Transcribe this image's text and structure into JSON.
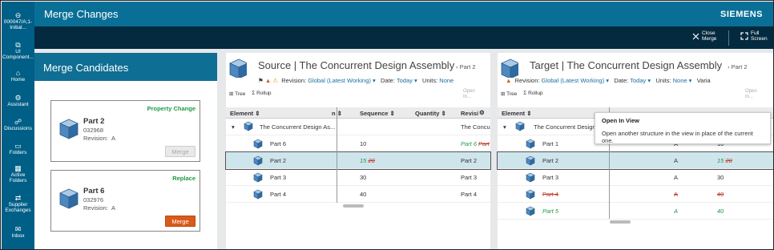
{
  "window": {
    "title": "Merge Changes",
    "brand": "SIEMENS"
  },
  "toolbar": {
    "close_merge": [
      "Close",
      "Merge"
    ],
    "full_screen": [
      "Full",
      "Screen"
    ]
  },
  "nav": [
    {
      "icon": "back-icon",
      "lines": [
        "000047/A;1-",
        "Initial..."
      ]
    },
    {
      "icon": "ui-component-icon",
      "lines": [
        "UI",
        "Component..."
      ]
    },
    {
      "icon": "home-icon",
      "lines": [
        "Home"
      ]
    },
    {
      "icon": "assistant-icon",
      "lines": [
        "Assistant"
      ]
    },
    {
      "icon": "discussions-icon",
      "lines": [
        "Discussions"
      ]
    },
    {
      "icon": "folders-icon",
      "lines": [
        "Folders"
      ]
    },
    {
      "icon": "active-folders-icon",
      "lines": [
        "Active",
        "Folders"
      ]
    },
    {
      "icon": "supplier-exchanges-icon",
      "lines": [
        "Supplier",
        "Exchanges"
      ]
    },
    {
      "icon": "inbox-icon",
      "lines": [
        "Inbox"
      ]
    }
  ],
  "merge_candidates": {
    "title": "Merge Candidates",
    "cards": [
      {
        "kind": "Property Change",
        "name": "Part 2",
        "id": "032968",
        "revision_label": "Revision:",
        "revision": "A",
        "button": "Merge",
        "enabled": false
      },
      {
        "kind": "Replace",
        "name": "Part 6",
        "id": "032976",
        "revision_label": "Revision:",
        "revision": "A",
        "button": "Merge",
        "enabled": true
      }
    ]
  },
  "source": {
    "title": "Source | The Concurrent Design Assembly",
    "crumb": "Part 2",
    "revision_label": "Revision:",
    "revision": "Global (Latest Working)",
    "date_label": "Date:",
    "date": "Today",
    "units_label": "Units:",
    "units": "None",
    "tools": [
      "Tree",
      "Rollup"
    ],
    "open_in_view": [
      "Open",
      "In..."
    ],
    "columns": [
      "Element",
      "n",
      "Sequence",
      "Quantity",
      "Revisi"
    ],
    "root": "The Concurrent Design As...",
    "root_rev": "The Concu",
    "rows": [
      {
        "name": "Part 6",
        "seq": "10",
        "seq_old": "",
        "rev": "Part 6",
        "rev_old": "Part",
        "sel": false
      },
      {
        "name": "Part 2",
        "seq": "15",
        "seq_old": "20",
        "rev": "Part 2",
        "rev_old": "",
        "sel": true
      },
      {
        "name": "Part 3",
        "seq": "30",
        "seq_old": "",
        "rev": "Part 3",
        "rev_old": "",
        "sel": false
      },
      {
        "name": "Part 4",
        "seq": "40",
        "seq_old": "",
        "rev": "Part 4",
        "rev_old": "",
        "sel": false
      }
    ]
  },
  "target": {
    "title": "Target | The Concurrent Design Assembly",
    "crumb": "Part 2",
    "revision_label": "Revision:",
    "revision": "Global (Latest Working)",
    "date_label": "Date:",
    "date": "Today",
    "units_label": "Units:",
    "units": "None",
    "variant_label": "Varia",
    "tools": [
      "Tree",
      "Rollup"
    ],
    "open_in_view": [
      "Open",
      "In..."
    ],
    "columns": [
      "Element"
    ],
    "root": "The Concurrent Design As...",
    "rows": [
      {
        "name": "Part 1",
        "rev": "A",
        "seq": "10",
        "seq_old": "",
        "style": "normal",
        "sel": false
      },
      {
        "name": "Part 2",
        "rev": "A",
        "seq": "15",
        "seq_old": "20",
        "style": "normal",
        "sel": true
      },
      {
        "name": "Part 3",
        "rev": "A",
        "seq": "30",
        "seq_old": "",
        "style": "normal",
        "sel": false
      },
      {
        "name": "Part 4",
        "rev": "A",
        "seq": "40",
        "seq_old": "",
        "style": "removed",
        "sel": false
      },
      {
        "name": "Part 5",
        "rev": "A",
        "seq": "40",
        "seq_old": "",
        "style": "added",
        "sel": false
      }
    ]
  },
  "tooltip": {
    "title": "Open In View",
    "text": "Open another structure in the view in place of the current one."
  },
  "colors": {
    "nav": "#005f87",
    "header": "#0a6f96",
    "toolbar": "#032a3e",
    "merge_btn": "#d95a1a",
    "added": "#1e9a48",
    "removed": "#c0392b"
  }
}
